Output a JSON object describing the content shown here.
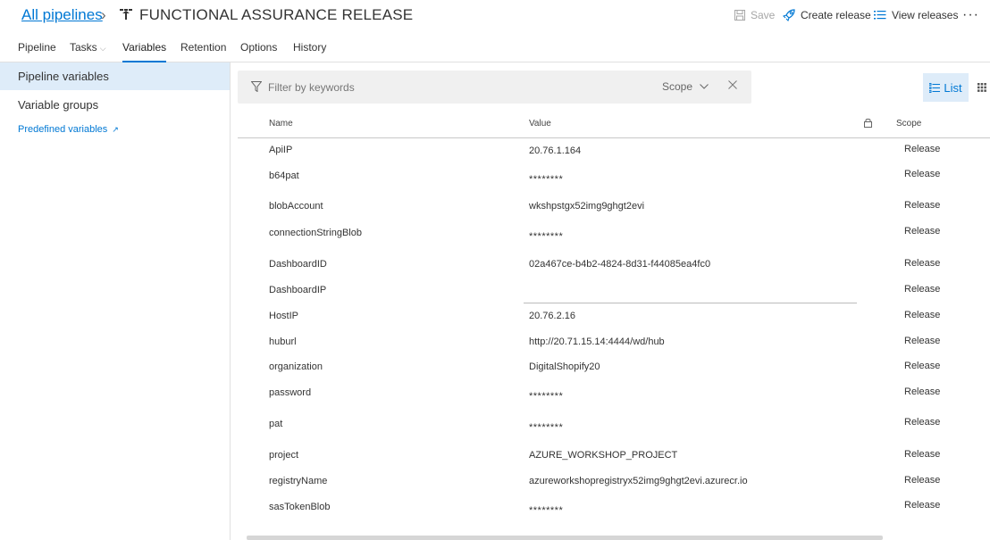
{
  "header": {
    "breadcrumb": "All pipelines",
    "title": "FUNCTIONAL ASSURANCE RELEASE",
    "save_label": "Save",
    "create_release_label": "Create release",
    "view_releases_label": "View releases",
    "more_label": "···"
  },
  "tabs": [
    {
      "label": "Pipeline"
    },
    {
      "label": "Tasks"
    },
    {
      "label": "Variables"
    },
    {
      "label": "Retention"
    },
    {
      "label": "Options"
    },
    {
      "label": "History"
    }
  ],
  "sidebar": {
    "items": [
      {
        "label": "Pipeline variables"
      },
      {
        "label": "Variable groups"
      }
    ],
    "predefined_link": "Predefined variables"
  },
  "filter": {
    "placeholder": "Filter by keywords",
    "scope_label": "Scope"
  },
  "view": {
    "list_label": "List"
  },
  "table": {
    "columns": {
      "name": "Name",
      "value": "Value",
      "scope": "Scope"
    },
    "rows": [
      {
        "name": "ApiIP",
        "value": "20.76.1.164",
        "scope": "Release"
      },
      {
        "name": "b64pat",
        "value": "********",
        "scope": "Release"
      },
      {
        "name": "blobAccount",
        "value": "wkshpstgx52img9ghgt2evi",
        "scope": "Release"
      },
      {
        "name": "connectionStringBlob",
        "value": "********",
        "scope": "Release"
      },
      {
        "name": "DashboardID",
        "value": "02a467ce-b4b2-4824-8d31-f44085ea4fc0",
        "scope": "Release"
      },
      {
        "name": "DashboardIP",
        "value": "",
        "scope": "Release"
      },
      {
        "name": "HostIP",
        "value": "20.76.2.16",
        "scope": "Release"
      },
      {
        "name": "huburl",
        "value": "http://20.71.15.14:4444/wd/hub",
        "scope": "Release"
      },
      {
        "name": "organization",
        "value": "DigitalShopify20",
        "scope": "Release"
      },
      {
        "name": "password",
        "value": "********",
        "scope": "Release"
      },
      {
        "name": "pat",
        "value": "********",
        "scope": "Release"
      },
      {
        "name": "project",
        "value": "AZURE_WORKSHOP_PROJECT",
        "scope": "Release"
      },
      {
        "name": "registryName",
        "value": "azureworkshopregistryx52img9ghgt2evi.azurecr.io",
        "scope": "Release"
      },
      {
        "name": "sasTokenBlob",
        "value": "********",
        "scope": "Release"
      }
    ]
  },
  "colors": {
    "accent": "#0078d4",
    "selected_bg": "#deecf9",
    "filter_bg": "#f0f0f0"
  }
}
